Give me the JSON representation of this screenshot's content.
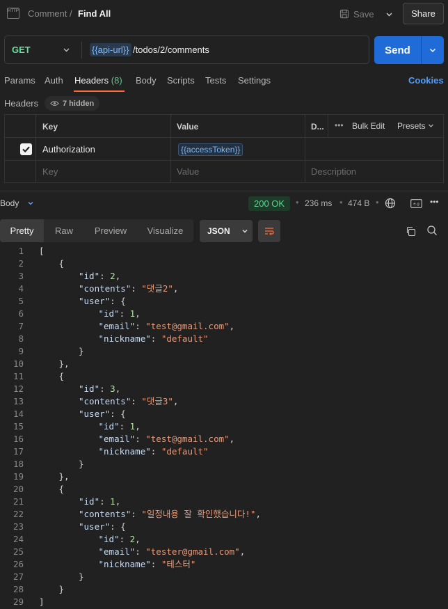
{
  "header": {
    "http_badge": "HTTP",
    "collection": "Comment",
    "separator": "/",
    "request_name": "Find All",
    "save_label": "Save",
    "share_label": "Share"
  },
  "request": {
    "method": "GET",
    "url_variable": "{{api-url}}",
    "url_path": "/todos/2/comments",
    "send_label": "Send"
  },
  "tabs": {
    "items": [
      "Params",
      "Auth",
      "Headers",
      "Body",
      "Scripts",
      "Tests",
      "Settings"
    ],
    "headers_count": "(8)",
    "cookies_label": "Cookies"
  },
  "headers_section": {
    "title": "Headers",
    "hidden_label": "7 hidden",
    "columns": {
      "key": "Key",
      "value": "Value",
      "description": "D...",
      "bulk_edit": "Bulk Edit",
      "presets": "Presets"
    },
    "rows": [
      {
        "checked": true,
        "key": "Authorization",
        "value": "{{accessToken}}"
      }
    ],
    "placeholders": {
      "key": "Key",
      "value": "Value",
      "description": "Description"
    }
  },
  "response": {
    "body_label": "Body",
    "status": "200 OK",
    "time": "236 ms",
    "size": "474 B",
    "view_tabs": [
      "Pretty",
      "Raw",
      "Preview",
      "Visualize"
    ],
    "format": "JSON",
    "body_json": [
      {
        "id": 2,
        "contents": "댓글2",
        "user": {
          "id": 1,
          "email": "test@gmail.com",
          "nickname": "default"
        }
      },
      {
        "id": 3,
        "contents": "댓글3",
        "user": {
          "id": 1,
          "email": "test@gmail.com",
          "nickname": "default"
        }
      },
      {
        "id": 1,
        "contents": "일정내용 잘 확인했습니다!",
        "user": {
          "id": 2,
          "email": "tester@gmail.com",
          "nickname": "테스터"
        }
      }
    ]
  },
  "colors": {
    "accent_tab": "#ff6c37",
    "send_button": "#1f6bd8",
    "method_get": "#6bdd9a",
    "status_ok": "#5fd491",
    "variable": "#7db7ff",
    "json_string": "#e99a78",
    "json_number": "#b9e0a5"
  }
}
